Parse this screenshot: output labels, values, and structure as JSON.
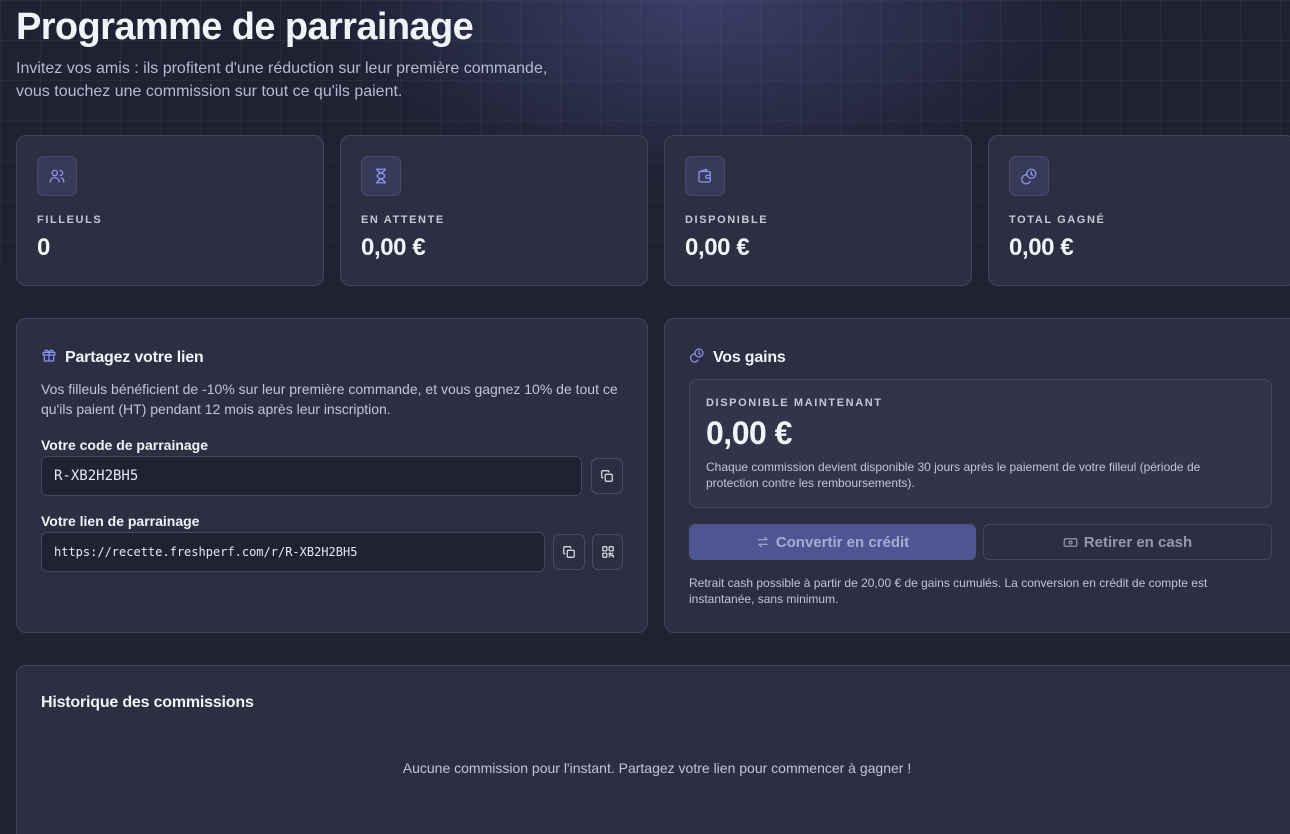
{
  "header": {
    "title": "Programme de parrainage",
    "subtitle_line1": "Invitez vos amis : ils profitent d'une réduction sur leur première commande,",
    "subtitle_line2": "vous touchez une commission sur tout ce qu'ils paient."
  },
  "stats": [
    {
      "label": "FILLEULS",
      "value": "0",
      "icon": "users-icon"
    },
    {
      "label": "EN ATTENTE",
      "value": "0,00 €",
      "icon": "hourglass-icon"
    },
    {
      "label": "DISPONIBLE",
      "value": "0,00 €",
      "icon": "wallet-icon"
    },
    {
      "label": "TOTAL GAGNÉ",
      "value": "0,00 €",
      "icon": "coins-icon"
    }
  ],
  "share": {
    "title": "Partagez votre lien",
    "description": "Vos filleuls bénéficient de -10% sur leur première commande, et vous gagnez 10% de tout ce qu'ils paient (HT) pendant 12 mois après leur inscription.",
    "code_label": "Votre code de parrainage",
    "code_value": "R-XB2H2BH5",
    "link_label": "Votre lien de parrainage",
    "link_value": "https://recette.freshperf.com/r/R-XB2H2BH5"
  },
  "gains": {
    "title": "Vos gains",
    "available_label": "DISPONIBLE MAINTENANT",
    "available_amount": "0,00 €",
    "available_note": "Chaque commission devient disponible 30 jours après le paiement de votre filleul (période de protection contre les remboursements).",
    "convert_label": "Convertir en crédit",
    "withdraw_label": "Retirer en cash",
    "footnote": "Retrait cash possible à partir de 20,00 € de gains cumulés. La conversion en crédit de compte est instantanée, sans minimum."
  },
  "history": {
    "title": "Historique des commissions",
    "empty_text": "Aucune commission pour l'instant. Partagez votre lien pour commencer à gagner !"
  },
  "colors": {
    "accent": "#8b93f0",
    "background": "#1f2233",
    "card": "#2c2f41",
    "primary_button": "#4d5592"
  }
}
